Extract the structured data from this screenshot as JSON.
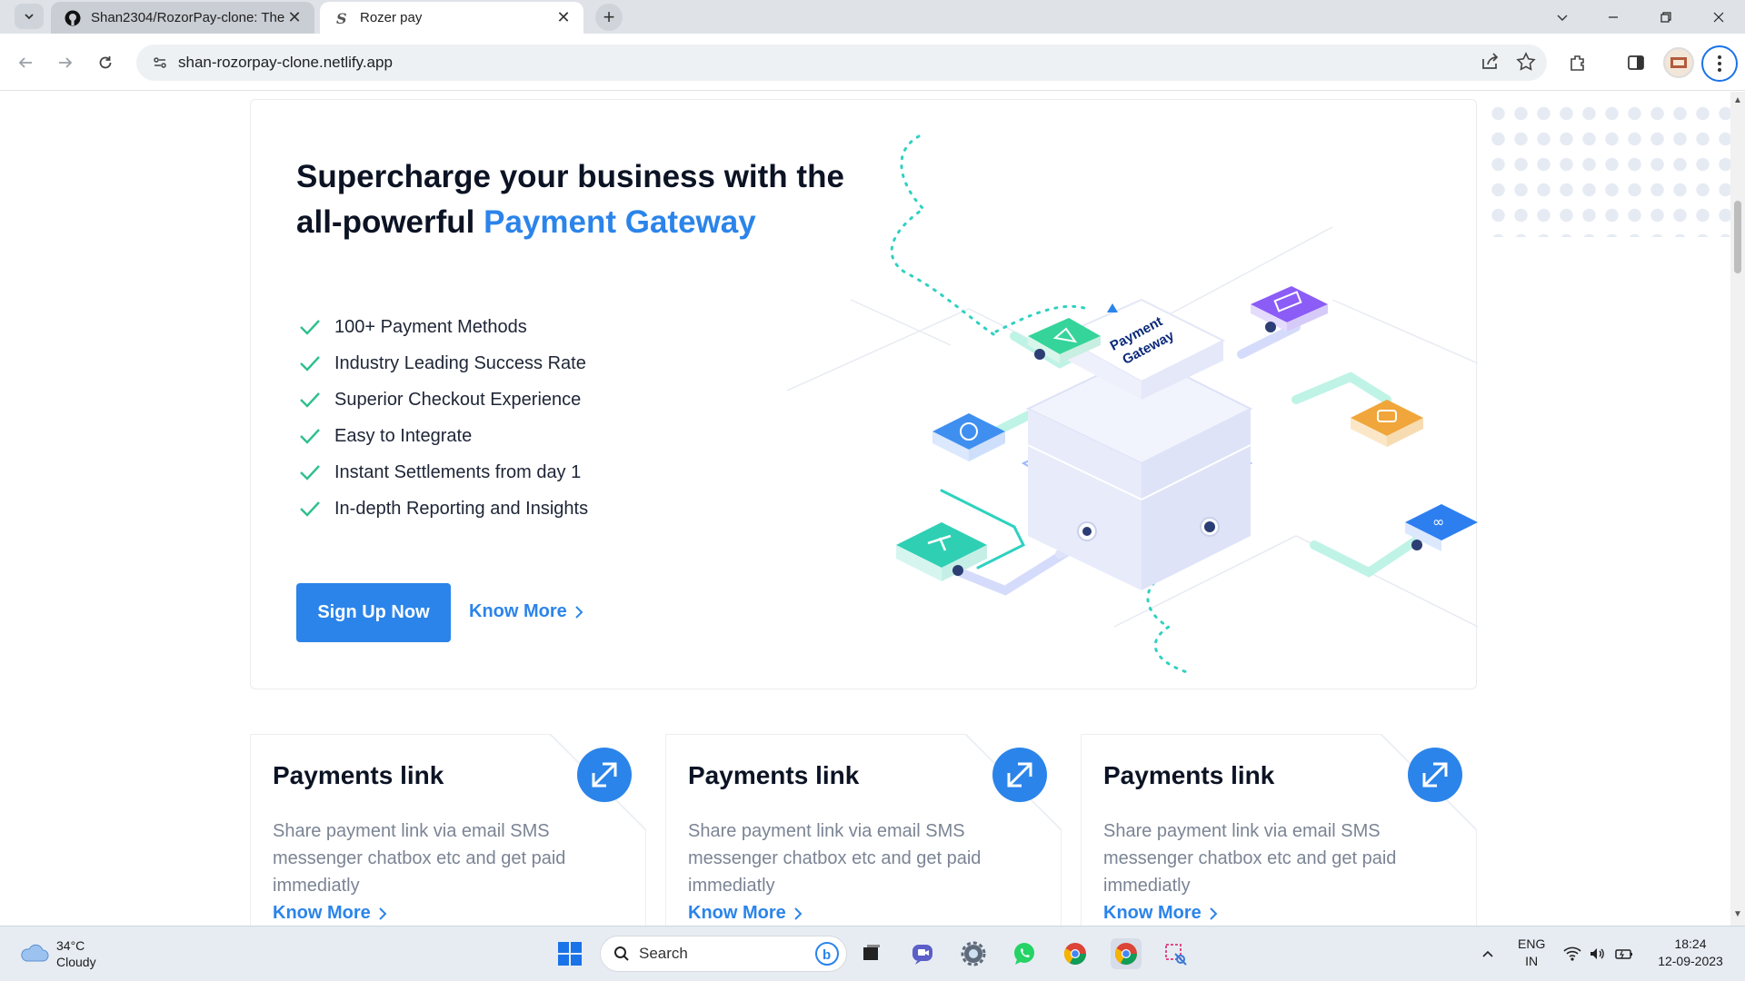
{
  "browser": {
    "tabs": [
      {
        "title": "Shan2304/RozorPay-clone: The I",
        "favicon": "github-icon",
        "active": false
      },
      {
        "title": "Rozer pay",
        "favicon": "s-logo-icon",
        "active": true
      }
    ],
    "url": "shan-rozorpay-clone.netlify.app"
  },
  "hero": {
    "title_line1": "Supercharge your business with the",
    "title_line2_prefix": "all-powerful ",
    "title_highlight": "Payment Gateway",
    "features": [
      "100+ Payment Methods",
      "Industry Leading Success Rate",
      "Superior Checkout Experience",
      "Easy to Integrate",
      "Instant Settlements from day 1",
      "In-depth Reporting and Insights"
    ],
    "cta_primary": "Sign Up Now",
    "cta_secondary": "Know More",
    "illustration_label_1": "Payment",
    "illustration_label_2": "Gateway"
  },
  "cards": [
    {
      "title": "Payments link",
      "text": "Share payment link via email SMS messenger chatbox etc and get paid immediatly",
      "link": "Know More"
    },
    {
      "title": "Payments link",
      "text": "Share payment link via email SMS messenger chatbox etc and get paid immediatly",
      "link": "Know More"
    },
    {
      "title": "Payments link",
      "text": "Share payment link via email SMS messenger chatbox etc and get paid immediatly",
      "link": "Know More"
    }
  ],
  "taskbar": {
    "weather_temp": "34°C",
    "weather_desc": "Cloudy",
    "search_label": "Search",
    "lang_1": "ENG",
    "lang_2": "IN",
    "time": "18:24",
    "date": "12-09-2023"
  },
  "colors": {
    "accent": "#2b84ea",
    "check": "#2fbf8f"
  }
}
